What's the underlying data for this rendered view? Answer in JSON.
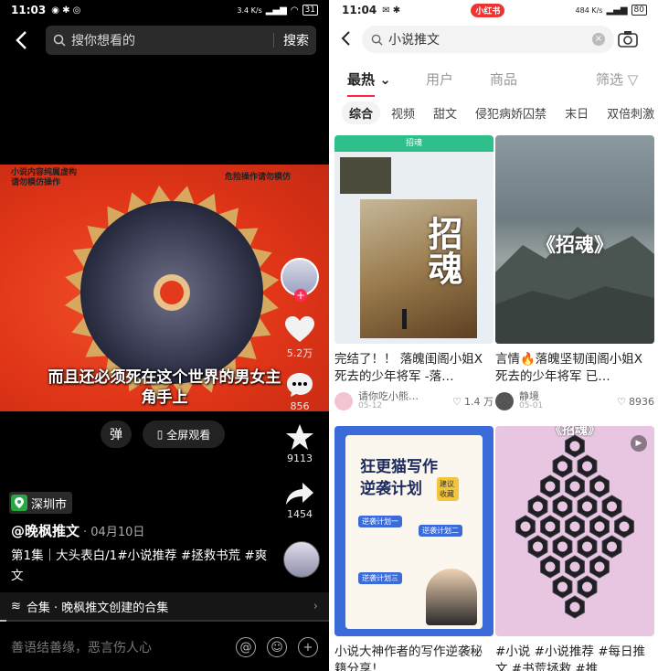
{
  "left": {
    "status": {
      "time": "11:03",
      "net": "3.4 K/s",
      "battery": "31"
    },
    "search_placeholder": "搜你想看的",
    "search_button": "搜索",
    "video_watermark_left": "小说内容纯属虚构\n请勿模仿操作",
    "video_watermark_right": "危险操作请勿模仿",
    "subtitle_line1": "而且还必须死在这个世界的男女主",
    "subtitle_line2": "角手上",
    "likes": "5.2万",
    "comments": "856",
    "favorites": "9113",
    "shares": "1454",
    "danmu_label": "弹",
    "fullscreen_label": "全屏观看",
    "location": "深圳市",
    "author": "@晚枫推文",
    "date": "· 04月10日",
    "description": "第1集｜大头表白/1#小说推荐 #拯救书荒 #爽文",
    "collection": "合集 · 晚枫推文创建的合集",
    "comment_placeholder": "善语结善缘，恶言伤人心",
    "progress": 0.02
  },
  "right": {
    "status": {
      "time": "11:04",
      "net": "484 K/s",
      "battery": "80",
      "badge": "小红书"
    },
    "search_query": "小说推文",
    "tabs": {
      "hot": "最热",
      "user": "用户",
      "goods": "商品",
      "filter": "筛选"
    },
    "chips": [
      "综合",
      "视频",
      "甜文",
      "侵犯病娇囚禁",
      "末日",
      "双倍刺激"
    ],
    "cards": [
      {
        "title": "完结了！！ 落魄闺阁小姐X死去的少年将军 -落…",
        "author": "请你吃小熊…",
        "date": "05-12",
        "likes": "1.4 万",
        "cover_big": "招魂",
        "cover_top": "招魂"
      },
      {
        "title": "言情🔥落魄坚韧闺阁小姐X死去的少年将军 已…",
        "author": "静境",
        "date": "05-01",
        "likes": "8936",
        "cover_text": "《招魂》"
      },
      {
        "title": "小说大神作者的写作逆袭秘籍分享！",
        "cover_line1": "狂更猫写作",
        "cover_line2": "逆袭计划",
        "cover_tag": "建议收藏",
        "cover_sub1": "逆袭计划一",
        "cover_sub2": "逆袭计划二",
        "cover_sub3": "逆袭计划三"
      },
      {
        "title": "#小说 #小说推荐 #每日推文 #书荒拯救 #推…",
        "cover_top": "《招魂》"
      }
    ]
  }
}
